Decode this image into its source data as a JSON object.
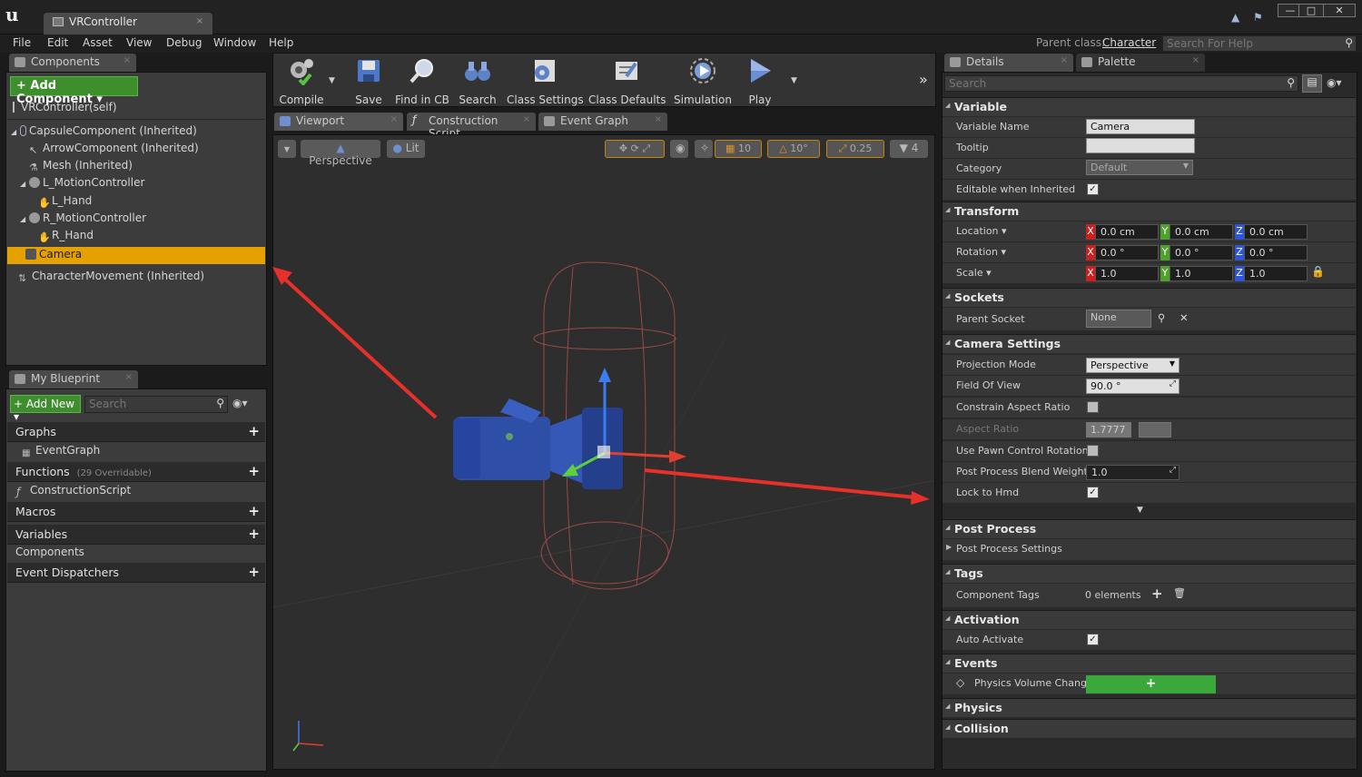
{
  "window": {
    "doc_tab": "VRController",
    "close_glyph": "×"
  },
  "menu": [
    "File",
    "Edit",
    "Asset",
    "View",
    "Debug",
    "Window",
    "Help"
  ],
  "parent_class": {
    "label": "Parent class:",
    "value": "Character"
  },
  "help_search": {
    "placeholder": "Search For Help"
  },
  "components_panel": {
    "tab": "Components",
    "add_button": "+ Add Component ▾",
    "self": "VRController(self)",
    "tree": [
      {
        "label": "CapsuleComponent (Inherited)",
        "icon": "capsule-icon"
      },
      {
        "label": "ArrowComponent (Inherited)",
        "icon": "arrow-icon"
      },
      {
        "label": "Mesh (Inherited)",
        "icon": "mesh-icon"
      },
      {
        "label": "L_MotionController",
        "icon": "motion-controller-icon"
      },
      {
        "label": "L_Hand",
        "icon": "hand-icon"
      },
      {
        "label": "R_MotionController",
        "icon": "motion-controller-icon"
      },
      {
        "label": "R_Hand",
        "icon": "hand-icon"
      },
      {
        "label": "Camera",
        "icon": "camera-icon",
        "selected": true
      },
      {
        "label": "CharacterMovement (Inherited)",
        "icon": "movement-icon"
      }
    ]
  },
  "my_blueprint": {
    "tab": "My Blueprint",
    "add_new": "+ Add New ▾",
    "search_placeholder": "Search",
    "sections": {
      "graphs": "Graphs",
      "event_graph": "EventGraph",
      "functions": "Functions",
      "functions_note": "(29 Overridable)",
      "construction_script": "ConstructionScript",
      "macros": "Macros",
      "variables": "Variables",
      "components": "Components",
      "event_dispatchers": "Event Dispatchers"
    }
  },
  "toolbar": {
    "buttons": [
      "Compile",
      "Save",
      "Find in CB",
      "Search",
      "Class Settings",
      "Class Defaults",
      "Simulation",
      "Play"
    ]
  },
  "editor_tabs": [
    "Viewport",
    "Construction Script",
    "Event Graph"
  ],
  "viewport": {
    "perspective": "Perspective",
    "lit": "Lit",
    "grid_snap": "10",
    "rot_snap": "10°",
    "scale_snap": "0.25",
    "camera_speed": "4"
  },
  "details": {
    "tab": "Details",
    "palette_tab": "Palette",
    "search_placeholder": "Search",
    "variable": {
      "header": "Variable",
      "name_label": "Variable Name",
      "name_value": "Camera",
      "tooltip_label": "Tooltip",
      "tooltip_value": "",
      "category_label": "Category",
      "category_value": "Default",
      "editable_label": "Editable when Inherited",
      "editable": true
    },
    "transform": {
      "header": "Transform",
      "location_label": "Location ▾",
      "location": [
        "0.0 cm",
        "0.0 cm",
        "0.0 cm"
      ],
      "rotation_label": "Rotation ▾",
      "rotation": [
        "0.0 °",
        "0.0 °",
        "0.0 °"
      ],
      "scale_label": "Scale ▾",
      "scale": [
        "1.0",
        "1.0",
        "1.0"
      ],
      "axes": [
        "X",
        "Y",
        "Z"
      ]
    },
    "sockets": {
      "header": "Sockets",
      "parent_label": "Parent Socket",
      "parent_value": "None"
    },
    "camera_settings": {
      "header": "Camera Settings",
      "projection_label": "Projection Mode",
      "projection_value": "Perspective",
      "fov_label": "Field Of View",
      "fov_value": "90.0 °",
      "constrain_label": "Constrain Aspect Ratio",
      "aspect_label": "Aspect Ratio",
      "aspect_value": "1.7777",
      "pawn_rot_label": "Use Pawn Control Rotation",
      "blend_label": "Post Process Blend Weight",
      "blend_value": "1.0",
      "lock_hmd_label": "Lock to Hmd",
      "lock_hmd": true
    },
    "post_process": {
      "header": "Post Process",
      "settings_label": "Post Process Settings"
    },
    "tags": {
      "header": "Tags",
      "label": "Component Tags",
      "value": "0 elements"
    },
    "activation": {
      "header": "Activation",
      "label": "Auto Activate",
      "checked": true
    },
    "events": {
      "header": "Events",
      "label": "Physics Volume Change"
    },
    "physics": {
      "header": "Physics"
    },
    "collision": {
      "header": "Collision"
    }
  },
  "colors": {
    "accent_selected": "#e5a100",
    "green_button": "#3e8e2e",
    "arrow_annotation": "#e8302a"
  }
}
